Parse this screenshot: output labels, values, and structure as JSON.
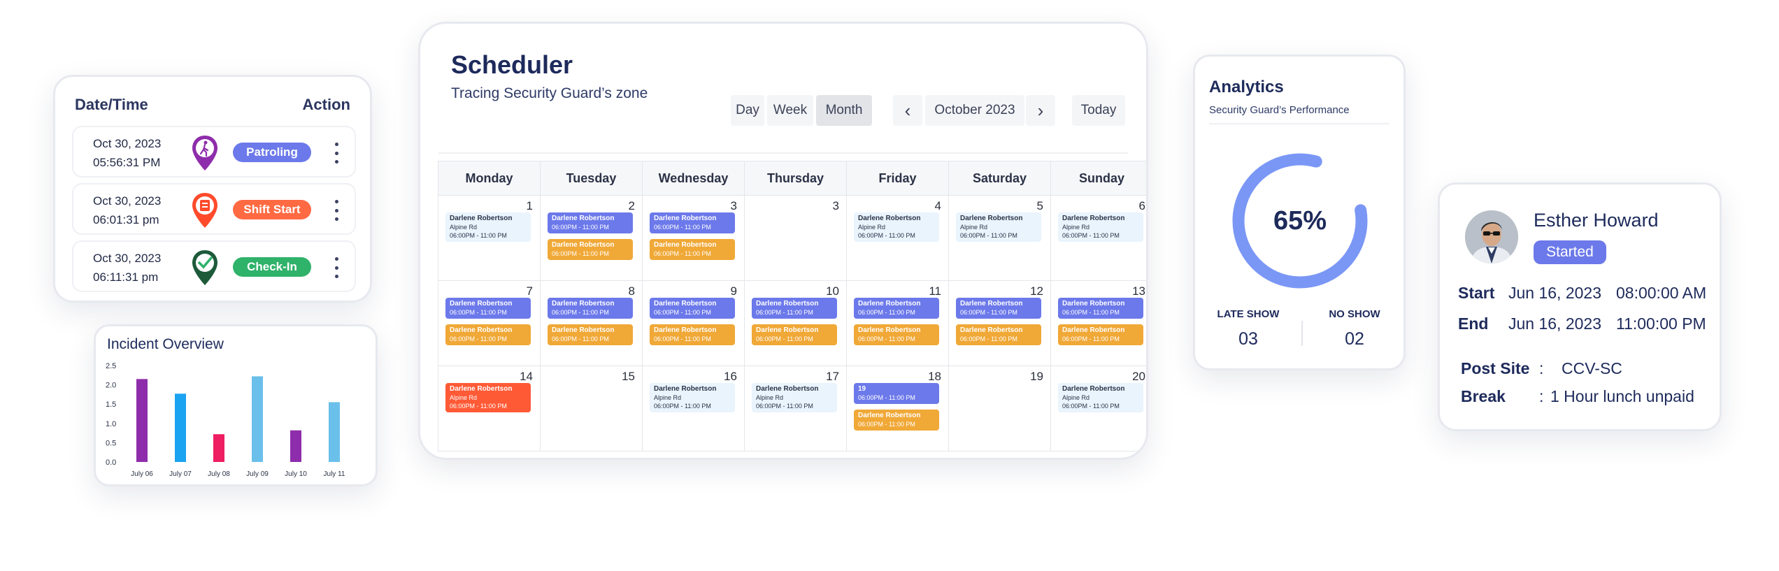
{
  "activity": {
    "header_left": "Date/Time",
    "header_right": "Action",
    "rows": [
      {
        "date": "Oct 30, 2023",
        "time": "05:56:31 PM",
        "action": "Patroling",
        "color": "#6c79ea",
        "icon": "walking-person-pin-icon"
      },
      {
        "date": "Oct 30, 2023",
        "time": "06:01:31 pm",
        "action": "Shift Start",
        "color": "#ff6a43",
        "icon": "shift-start-pin-icon"
      },
      {
        "date": "Oct 30, 2023",
        "time": "06:11:31 pm",
        "action": "Check-In",
        "color": "#2fb26a",
        "icon": "check-pin-icon"
      }
    ]
  },
  "incident": {
    "title": "Incident Overview"
  },
  "chart_data": {
    "type": "bar",
    "title": "Incident Overview",
    "categories": [
      "July 06",
      "July 07",
      "July 08",
      "July 09",
      "July 10",
      "July 11"
    ],
    "values": [
      2.15,
      1.77,
      0.72,
      2.22,
      0.82,
      1.55
    ],
    "colors": [
      "#8e2dab",
      "#1aa3f0",
      "#ee1e62",
      "#6ac0ea",
      "#8e2dab",
      "#6ac0ea"
    ],
    "y_ticks": [
      "2.5",
      "2.0",
      "1.5",
      "1.0",
      "0.5",
      "0.0"
    ],
    "ylim": [
      0,
      2.5
    ],
    "grid": false
  },
  "scheduler": {
    "title": "Scheduler",
    "subtitle": "Tracing Security Guard’s zone",
    "views": [
      "Day",
      "Week",
      "Month"
    ],
    "active_view": "Month",
    "month": "October 2023",
    "today": "Today",
    "prev_icon": "‹",
    "next_icon": "›",
    "weekdays": [
      "Monday",
      "Tuesday",
      "Wednesday",
      "Thursday",
      "Friday",
      "Saturday",
      "Sunday"
    ],
    "cells": [
      {
        "day": "1",
        "events": [
          {
            "type": "light",
            "name": "Darlene Robertson",
            "place": "Alpine Rd",
            "time": "06:00PM - 11:00 PM"
          }
        ]
      },
      {
        "day": "2",
        "events": [
          {
            "type": "purple",
            "name": "Darlene Robertson",
            "place": "",
            "time": "06:00PM - 11:00 PM"
          },
          {
            "type": "orange",
            "name": "Darlene Robertson",
            "place": "",
            "time": "06:00PM - 11:00 PM"
          }
        ]
      },
      {
        "day": "3",
        "events": [
          {
            "type": "purple",
            "name": "Darlene Robertson",
            "place": "",
            "time": "06:00PM - 11:00 PM"
          },
          {
            "type": "orange",
            "name": "Darlene Robertson",
            "place": "",
            "time": "06:00PM - 11:00 PM"
          }
        ]
      },
      {
        "day": "3",
        "events": []
      },
      {
        "day": "4",
        "events": [
          {
            "type": "light",
            "name": "Darlene Robertson",
            "place": "Alpine Rd",
            "time": "06:00PM - 11:00 PM"
          }
        ]
      },
      {
        "day": "5",
        "events": [
          {
            "type": "light",
            "name": "Darlene Robertson",
            "place": "Alpine Rd",
            "time": "06:00PM - 11:00 PM"
          }
        ]
      },
      {
        "day": "6",
        "events": [
          {
            "type": "light",
            "name": "Darlene Robertson",
            "place": "Alpine Rd",
            "time": "06:00PM - 11:00 PM"
          }
        ]
      },
      {
        "day": "7",
        "events": [
          {
            "type": "purple",
            "name": "Darlene Robertson",
            "place": "",
            "time": "06:00PM - 11:00 PM"
          },
          {
            "type": "orange",
            "name": "Darlene Robertson",
            "place": "",
            "time": "06:00PM - 11:00 PM"
          }
        ]
      },
      {
        "day": "8",
        "events": [
          {
            "type": "purple",
            "name": "Darlene Robertson",
            "place": "",
            "time": "06:00PM - 11:00 PM"
          },
          {
            "type": "orange",
            "name": "Darlene Robertson",
            "place": "",
            "time": "06:00PM - 11:00 PM"
          }
        ]
      },
      {
        "day": "9",
        "events": [
          {
            "type": "purple",
            "name": "Darlene Robertson",
            "place": "",
            "time": "06:00PM - 11:00 PM"
          },
          {
            "type": "orange",
            "name": "Darlene Robertson",
            "place": "",
            "time": "06:00PM - 11:00 PM"
          }
        ]
      },
      {
        "day": "10",
        "events": [
          {
            "type": "purple",
            "name": "Darlene Robertson",
            "place": "",
            "time": "06:00PM - 11:00 PM"
          },
          {
            "type": "orange",
            "name": "Darlene Robertson",
            "place": "",
            "time": "06:00PM - 11:00 PM"
          }
        ]
      },
      {
        "day": "11",
        "events": [
          {
            "type": "purple",
            "name": "Darlene Robertson",
            "place": "",
            "time": "06:00PM - 11:00 PM"
          },
          {
            "type": "orange",
            "name": "Darlene Robertson",
            "place": "",
            "time": "06:00PM - 11:00 PM"
          }
        ]
      },
      {
        "day": "12",
        "events": [
          {
            "type": "purple",
            "name": "Darlene Robertson",
            "place": "",
            "time": "06:00PM - 11:00 PM"
          },
          {
            "type": "orange",
            "name": "Darlene Robertson",
            "place": "",
            "time": "06:00PM - 11:00 PM"
          }
        ]
      },
      {
        "day": "13",
        "events": [
          {
            "type": "purple",
            "name": "Darlene Robertson",
            "place": "",
            "time": "06:00PM - 11:00 PM"
          },
          {
            "type": "orange",
            "name": "Darlene Robertson",
            "place": "",
            "time": "06:00PM - 11:00 PM"
          }
        ]
      },
      {
        "day": "14",
        "events": [
          {
            "type": "red",
            "name": "Darlene Robertson",
            "place": "Alpine Rd",
            "time": "06:00PM - 11:00 PM"
          }
        ]
      },
      {
        "day": "15",
        "events": []
      },
      {
        "day": "16",
        "events": [
          {
            "type": "light",
            "name": "Darlene Robertson",
            "place": "Alpine Rd",
            "time": "06:00PM - 11:00 PM"
          }
        ]
      },
      {
        "day": "17",
        "events": [
          {
            "type": "light",
            "name": "Darlene Robertson",
            "place": "Alpine Rd",
            "time": "06:00PM - 11:00 PM"
          }
        ]
      },
      {
        "day": "18",
        "events": [
          {
            "type": "purple",
            "name": "19",
            "place": "",
            "time": "06:00PM - 11:00 PM"
          },
          {
            "type": "orange",
            "name": "Darlene Robertson",
            "place": "",
            "time": "06:00PM - 11:00 PM"
          }
        ]
      },
      {
        "day": "19",
        "events": []
      },
      {
        "day": "20",
        "events": [
          {
            "type": "light",
            "name": "Darlene Robertson",
            "place": "Alpine Rd",
            "time": "06:00PM - 11:00 PM"
          }
        ]
      }
    ]
  },
  "analytics": {
    "title": "Analytics",
    "subtitle": "Security Guard’s Performance",
    "percent_label": "65%",
    "percent_value": 0.65,
    "ring_color": "#7a97f5",
    "late_show_label": "LATE SHOW",
    "late_show_value": "03",
    "no_show_label": "NO SHOW",
    "no_show_value": "02"
  },
  "profile": {
    "name": "Esther Howard",
    "status": "Started",
    "start_label": "Start",
    "start_date": "Jun 16, 2023",
    "start_time": "08:00:00 AM",
    "end_label": "End",
    "end_date": "Jun 16, 2023",
    "end_time": "11:00:00 PM",
    "post_label": "Post Site",
    "post_value": "CCV-SC",
    "break_label": "Break",
    "break_value": "1 Hour lunch unpaid",
    "colon": ":"
  }
}
